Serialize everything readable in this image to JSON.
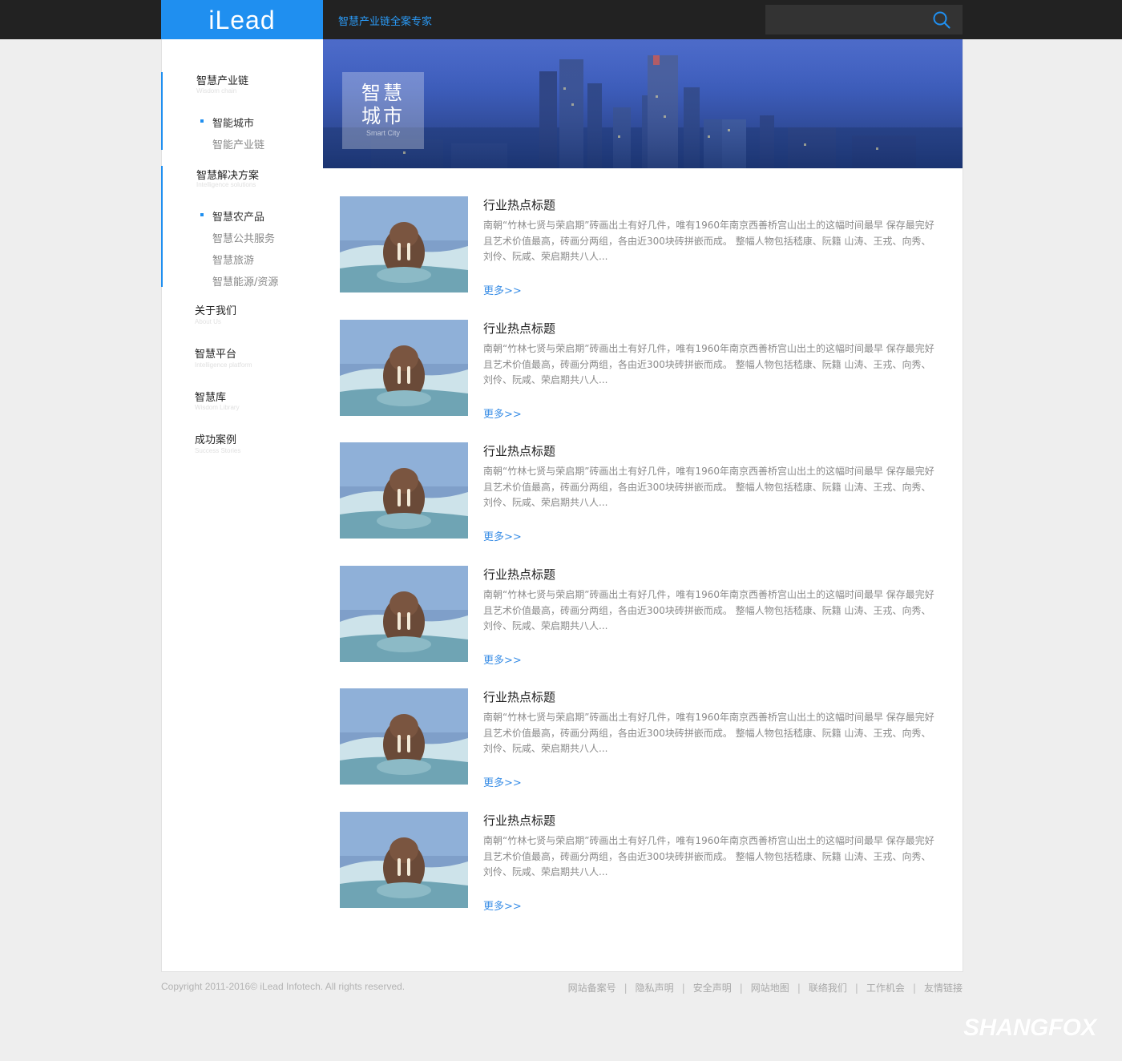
{
  "header": {
    "logo": "iLead",
    "tagline": "智慧产业链全案专家",
    "search": {
      "value": "",
      "placeholder": ""
    }
  },
  "sidebar": {
    "groups": [
      {
        "title": "智慧产业链",
        "subtitle": "Wisdom chain",
        "active": true,
        "items": [
          {
            "label": "智能城市",
            "current": true
          },
          {
            "label": "智能产业链",
            "current": false
          }
        ]
      },
      {
        "title": "智慧解决方案",
        "subtitle": "Intelligence solutions",
        "active": true,
        "items": [
          {
            "label": "智慧农产品",
            "current": true
          },
          {
            "label": "智慧公共服务",
            "current": false
          },
          {
            "label": "智慧旅游",
            "current": false
          },
          {
            "label": "智慧能源/资源",
            "current": false
          }
        ]
      },
      {
        "title": "关于我们",
        "subtitle": "About Us",
        "active": false,
        "items": []
      },
      {
        "title": "智慧平台",
        "subtitle": "Intelligence platform",
        "active": false,
        "items": []
      },
      {
        "title": "智慧库",
        "subtitle": "Wisdom Library",
        "active": false,
        "items": []
      },
      {
        "title": "成功案例",
        "subtitle": "Success Stories",
        "active": false,
        "items": []
      }
    ]
  },
  "banner": {
    "title": "智慧城市",
    "subtitle": "Smart City"
  },
  "articles": [
    {
      "title": "行业热点标题",
      "desc": "南朝“竹林七贤与荣启期”砖画出土有好几件，唯有1960年南京西善桥宫山出土的这幅时间最早 保存最完好且艺术价值最高，砖画分两组，各由近300块砖拼嵌而成。 整幅人物包括嵇康、阮籍 山涛、王戎、向秀、刘伶、阮咸、荣启期共八人...",
      "more": "更多>>"
    },
    {
      "title": "行业热点标题",
      "desc": "南朝“竹林七贤与荣启期”砖画出土有好几件，唯有1960年南京西善桥宫山出土的这幅时间最早 保存最完好且艺术价值最高，砖画分两组，各由近300块砖拼嵌而成。 整幅人物包括嵇康、阮籍 山涛、王戎、向秀、刘伶、阮咸、荣启期共八人...",
      "more": "更多>>"
    },
    {
      "title": "行业热点标题",
      "desc": "南朝“竹林七贤与荣启期”砖画出土有好几件，唯有1960年南京西善桥宫山出土的这幅时间最早 保存最完好且艺术价值最高，砖画分两组，各由近300块砖拼嵌而成。 整幅人物包括嵇康、阮籍 山涛、王戎、向秀、刘伶、阮咸、荣启期共八人...",
      "more": "更多>>"
    },
    {
      "title": "行业热点标题",
      "desc": "南朝“竹林七贤与荣启期”砖画出土有好几件，唯有1960年南京西善桥宫山出土的这幅时间最早 保存最完好且艺术价值最高，砖画分两组，各由近300块砖拼嵌而成。 整幅人物包括嵇康、阮籍 山涛、王戎、向秀、刘伶、阮咸、荣启期共八人...",
      "more": "更多>>"
    },
    {
      "title": "行业热点标题",
      "desc": "南朝“竹林七贤与荣启期”砖画出土有好几件，唯有1960年南京西善桥宫山出土的这幅时间最早 保存最完好且艺术价值最高，砖画分两组，各由近300块砖拼嵌而成。 整幅人物包括嵇康、阮籍 山涛、王戎、向秀、刘伶、阮咸、荣启期共八人...",
      "more": "更多>>"
    },
    {
      "title": "行业热点标题",
      "desc": "南朝“竹林七贤与荣启期”砖画出土有好几件，唯有1960年南京西善桥宫山出土的这幅时间最早 保存最完好且艺术价值最高，砖画分两组，各由近300块砖拼嵌而成。 整幅人物包括嵇康、阮籍 山涛、王戎、向秀、刘伶、阮咸、荣启期共八人...",
      "more": "更多>>"
    }
  ],
  "footer": {
    "copyright": "Copyright 2011-2016© iLead Infotech. All rights reserved.",
    "links": [
      "网站备案号",
      "隐私声明",
      "安全声明",
      "网站地图",
      "联络我们",
      "工作机会",
      "友情链接"
    ],
    "separator": "|"
  },
  "watermark": "SHANGFOX",
  "icons": {
    "search": "search-icon",
    "thumbnail": "walrus-photo"
  },
  "colors": {
    "accent": "#1f8ff0",
    "topbar": "#222222",
    "link": "#3a8ee6"
  }
}
